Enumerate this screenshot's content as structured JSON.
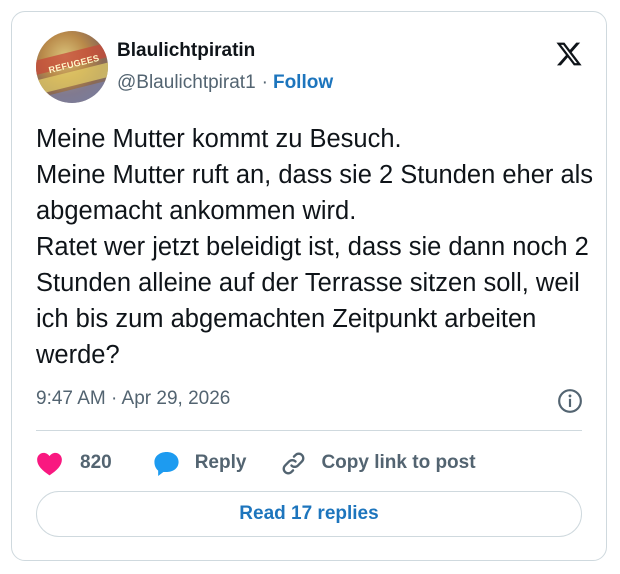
{
  "author": {
    "name": "Blaulichtpiratin",
    "handle": "@Blaulichtpirat1",
    "separator": "·",
    "follow_label": "Follow",
    "avatar_text": "REFUGEES"
  },
  "tweet": {
    "text": "Meine Mutter kommt zu Besuch.\nMeine Mutter ruft an, dass sie 2 Stunden eher als abgemacht ankommen wird.\nRatet wer jetzt beleidigt ist, dass sie dann noch 2 Stunden alleine auf der Terrasse sitzen soll, weil ich bis zum abgemachten Zeitpunkt arbeiten werde?",
    "timestamp": "9:47 AM · Apr 29, 2026"
  },
  "actions": {
    "likes_count": "820",
    "reply_label": "Reply",
    "copy_label": "Copy link to post"
  },
  "footer": {
    "read_replies_label": "Read 17 replies"
  },
  "icons": {
    "logo": "x-logo-icon",
    "info": "info-icon",
    "like": "heart-icon",
    "reply": "speech-bubble-icon",
    "copy": "link-icon"
  },
  "colors": {
    "accent": "#1d75bd",
    "heart": "#f91880",
    "reply_bubble": "#1d9bf0",
    "secondary_text": "#536471",
    "border": "#cfd9de"
  }
}
